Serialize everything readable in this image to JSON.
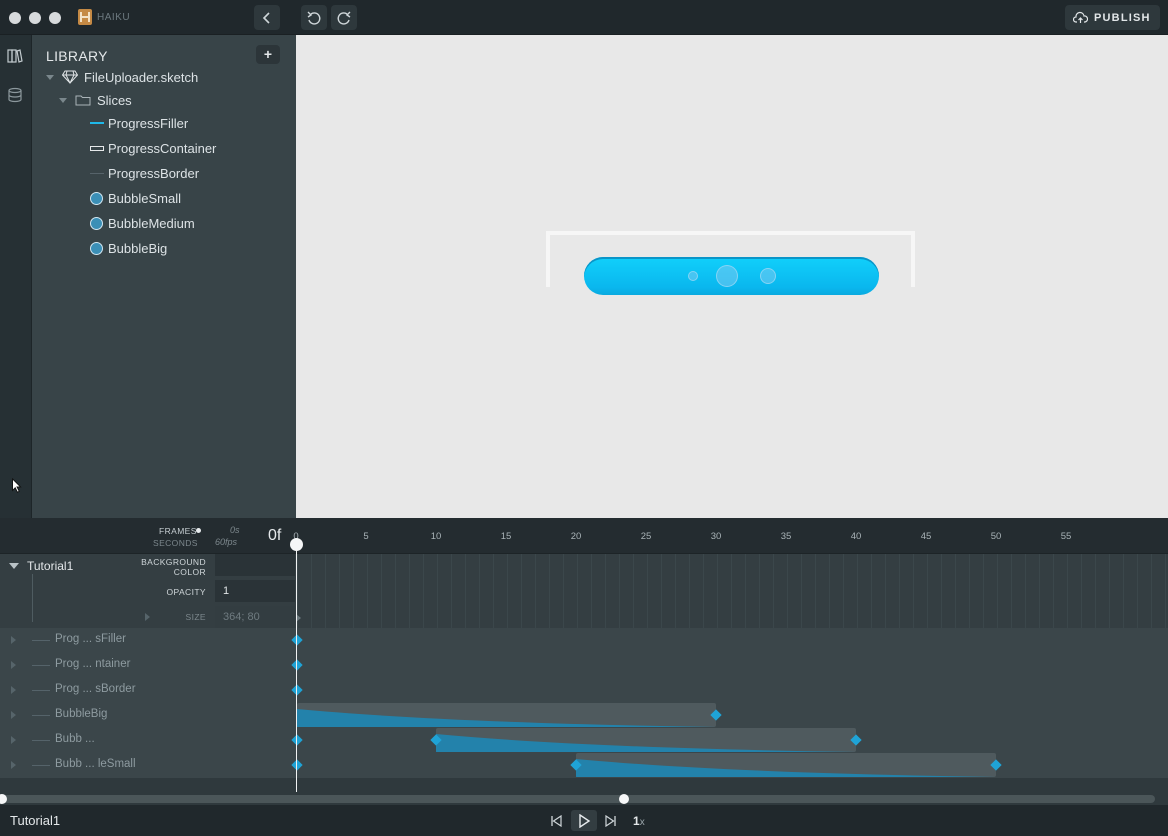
{
  "titlebar": {
    "brand": "HAIKU",
    "publish_label": "PUBLISH"
  },
  "library": {
    "title": "LIBRARY",
    "add_label": "+",
    "file": "FileUploader.sketch",
    "folder": "Slices",
    "items": [
      {
        "label": "ProgressFiller",
        "swatch": "line"
      },
      {
        "label": "ProgressContainer",
        "swatch": "rect"
      },
      {
        "label": "ProgressBorder",
        "swatch": "thin"
      },
      {
        "label": "BubbleSmall",
        "swatch": "circle"
      },
      {
        "label": "BubbleMedium",
        "swatch": "circle"
      },
      {
        "label": "BubbleBig",
        "swatch": "circle"
      }
    ]
  },
  "stage": {
    "background": "#e8e8e8",
    "pill_color": "#11c6f7"
  },
  "timeline": {
    "frames_label": "FRAMES",
    "seconds_label": "SECONDS",
    "time_seconds": "0s",
    "fps": "60fps",
    "current_frame": "0f",
    "ticks": [
      "0",
      "5",
      "10",
      "15",
      "20",
      "25",
      "30",
      "35",
      "40",
      "45",
      "50",
      "55"
    ],
    "component_name": "Tutorial1",
    "properties": [
      {
        "label_line1": "BACKGROUND",
        "label_line2": "COLOR",
        "value": ""
      },
      {
        "label_line1": "OPACITY",
        "label_line2": "",
        "value": "1"
      },
      {
        "label_line1": "SIZE",
        "label_line2": "",
        "value": "364; 80"
      }
    ],
    "rows": [
      {
        "label": "Prog ... sFiller"
      },
      {
        "label": "Prog ... ntainer"
      },
      {
        "label": "Prog ... sBorder"
      },
      {
        "label": "BubbleBig"
      },
      {
        "label": "Bubb ..."
      },
      {
        "label": "Bubb ... leSmall"
      }
    ]
  },
  "footer": {
    "component": "Tutorial1",
    "speed_value": "1",
    "speed_unit": "x"
  }
}
